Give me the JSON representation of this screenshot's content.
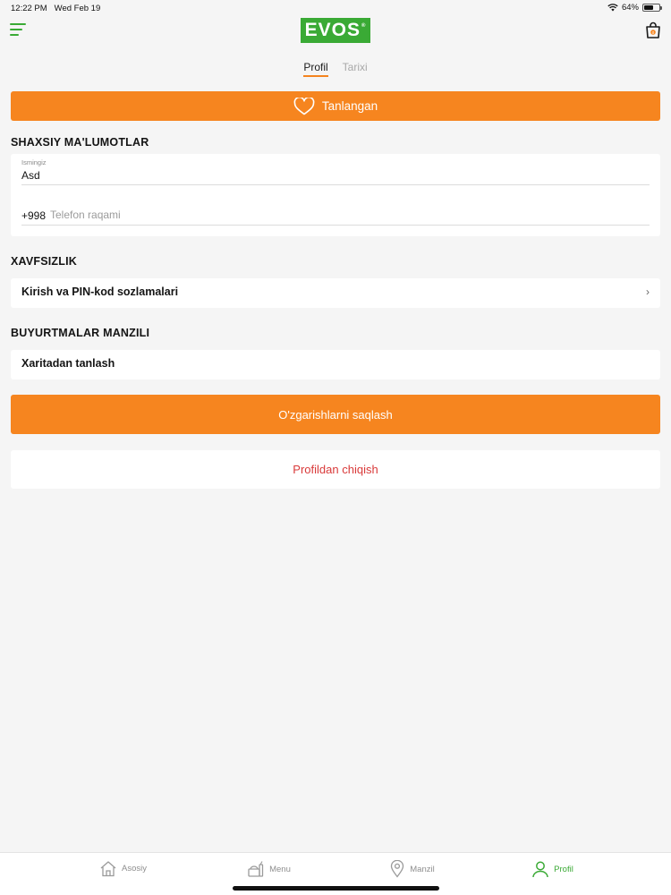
{
  "status_bar": {
    "time": "12:22 PM",
    "date": "Wed Feb 19",
    "battery": "64%",
    "battery_level": 0.64,
    "icons": [
      "wifi-icon",
      "battery-icon"
    ]
  },
  "header": {
    "logo_text": "EVOS",
    "logo_mark": "®",
    "brand_color": "#3aaa35",
    "cart_count": "0"
  },
  "tabs": [
    {
      "label": "Profil",
      "active": true
    },
    {
      "label": "Tarixi",
      "active": false
    }
  ],
  "favorites": {
    "label": "Tanlangan",
    "icon": "heart-icon",
    "accent_color": "#f6851f"
  },
  "personal": {
    "title": "SHAXSIY MA'LUMOTLAR",
    "name_label": "Ismingiz",
    "name_value": "Asd",
    "phone_prefix": "+998",
    "phone_placeholder": "Telefon raqami",
    "phone_value": ""
  },
  "security": {
    "title": "XAVFSIZLIK",
    "row_label": "Kirish va PIN-kod sozlamalari",
    "row_icon": "chevron-right-icon"
  },
  "address": {
    "title": "BUYURTMALAR MANZILI",
    "row_label": "Xaritadan tanlash"
  },
  "actions": {
    "save_label": "O'zgarishlarni saqlash",
    "logout_label": "Profildan chiqish",
    "logout_color": "#d93a3a"
  },
  "bottom_nav": [
    {
      "label": "Asosiy",
      "icon": "home-icon",
      "active": false
    },
    {
      "label": "Menu",
      "icon": "food-menu-icon",
      "active": false
    },
    {
      "label": "Manzil",
      "icon": "map-pin-icon",
      "active": false
    },
    {
      "label": "Profil",
      "icon": "user-icon",
      "active": true
    }
  ]
}
